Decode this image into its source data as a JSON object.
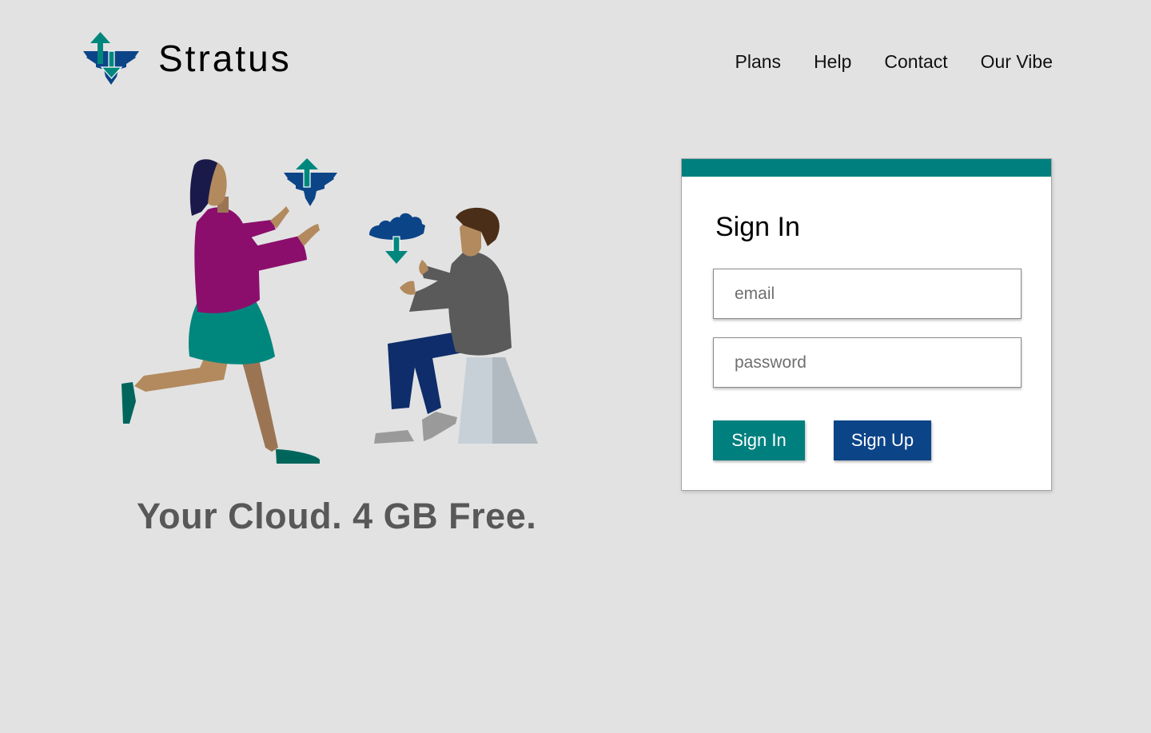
{
  "brand": {
    "name": "Stratus",
    "logo_icon": "cloud-arrows-icon"
  },
  "nav": {
    "items": [
      {
        "label": "Plans"
      },
      {
        "label": "Help"
      },
      {
        "label": "Contact"
      },
      {
        "label": "Our Vibe"
      }
    ]
  },
  "hero": {
    "tagline": "Your Cloud. 4 GB Free.",
    "illustration": "people-exchanging-cloud-icons"
  },
  "signin": {
    "title": "Sign In",
    "email_placeholder": "email",
    "password_placeholder": "password",
    "signin_label": "Sign In",
    "signup_label": "Sign Up"
  },
  "colors": {
    "background": "#e2e2e2",
    "teal": "#007f7f",
    "navy": "#0c4488",
    "tagline": "#585858"
  }
}
